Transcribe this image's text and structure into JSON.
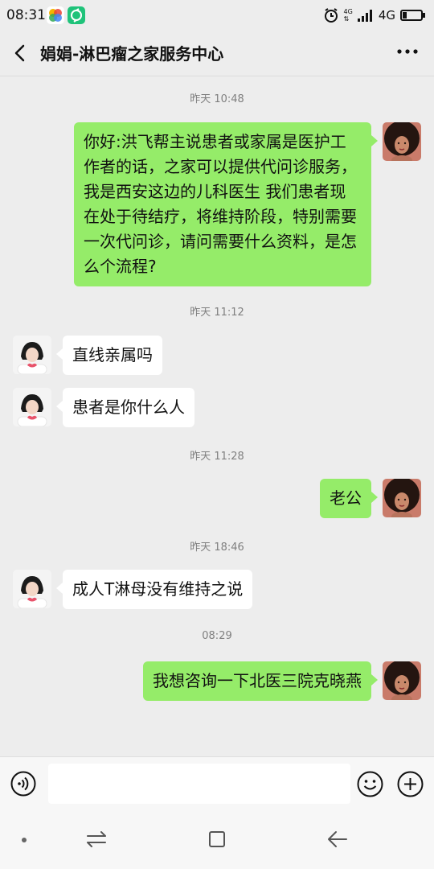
{
  "status_bar": {
    "time": "08:31",
    "net_small_top": "4G",
    "net_small_bottom": "⇅",
    "network": "4G"
  },
  "header": {
    "title": "娟娟-淋巴瘤之家服务中心"
  },
  "messages": [
    {
      "kind": "timestamp",
      "text": "昨天 10:48"
    },
    {
      "kind": "sent",
      "text": "你好:洪飞帮主说患者或家属是医护工作者的话，之家可以提供代问诊服务，我是西安这边的儿科医生 我们患者现在处于待结疗，将维持阶段，特别需要一次代问诊，请问需要什么资料，是怎么个流程?"
    },
    {
      "kind": "timestamp",
      "text": "昨天 11:12"
    },
    {
      "kind": "received",
      "text": "直线亲属吗"
    },
    {
      "kind": "received",
      "text": "患者是你什么人"
    },
    {
      "kind": "timestamp",
      "text": "昨天 11:28"
    },
    {
      "kind": "sent",
      "text": "老公"
    },
    {
      "kind": "timestamp",
      "text": "昨天 18:46"
    },
    {
      "kind": "received",
      "text": "成人T淋母没有维持之说"
    },
    {
      "kind": "timestamp",
      "text": "08:29"
    },
    {
      "kind": "sent",
      "text": "我想咨询一下北医三院克晓燕"
    }
  ],
  "input": {
    "value": ""
  },
  "colors": {
    "background": "#ededed",
    "sent_bubble": "#95ec69",
    "received_bubble": "#ffffff"
  }
}
